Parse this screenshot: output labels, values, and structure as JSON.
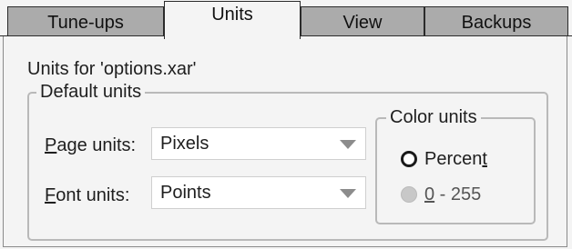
{
  "tabs": [
    {
      "label": "Tune-ups",
      "active": false
    },
    {
      "label": "Units",
      "active": true
    },
    {
      "label": "View",
      "active": false
    },
    {
      "label": "Backups",
      "active": false
    }
  ],
  "units_for_label": "Units for 'options.xar'",
  "default_units": {
    "legend": "Default units",
    "page_units": {
      "label_mnemonic": "P",
      "label_rest": "age units:",
      "value": "Pixels"
    },
    "font_units": {
      "label_mnemonic": "F",
      "label_rest": "ont units:",
      "value": "Points"
    }
  },
  "color_units": {
    "legend": "Color units",
    "options": [
      {
        "label_main": "Percen",
        "label_mnemonic": "t",
        "label_rest": "",
        "selected": true
      },
      {
        "label_main": "",
        "label_mnemonic": "0",
        "label_rest": " - 255",
        "selected": false
      }
    ]
  },
  "colors": {
    "tab_inactive_bg": "#ababab",
    "panel_bg": "#f4f4f4"
  }
}
